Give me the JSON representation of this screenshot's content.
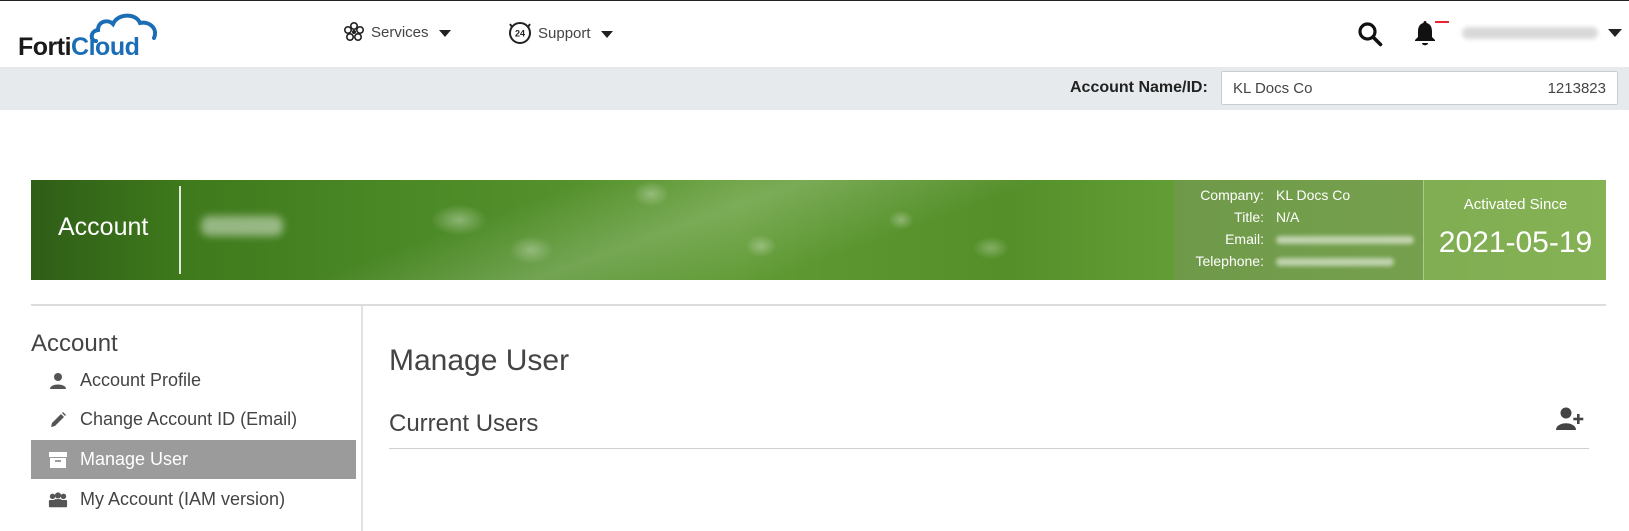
{
  "brand": {
    "name_part1": "Forti",
    "name_part2": "Cloud",
    "accent": "#1b6eb5"
  },
  "nav": {
    "services_label": "Services",
    "support_label": "Support",
    "support_badge": "24"
  },
  "account_bar": {
    "label": "Account Name/ID:",
    "account_name": "KL Docs Co",
    "account_id": "1213823"
  },
  "banner": {
    "title": "Account",
    "company_label": "Company:",
    "company_value": "KL Docs Co",
    "title_label": "Title:",
    "title_value": "N/A",
    "email_label": "Email:",
    "telephone_label": "Telephone:",
    "activated_label": "Activated Since",
    "activated_date": "2021-05-19"
  },
  "sidebar": {
    "title": "Account",
    "items": [
      {
        "label": "Account Profile",
        "icon": "user-icon"
      },
      {
        "label": "Change Account ID (Email)",
        "icon": "pencil-icon"
      },
      {
        "label": "Manage User",
        "icon": "archive-icon",
        "active": true
      },
      {
        "label": "My Account (IAM version)",
        "icon": "users-icon"
      }
    ]
  },
  "main": {
    "page_title": "Manage User",
    "section_title": "Current Users"
  }
}
